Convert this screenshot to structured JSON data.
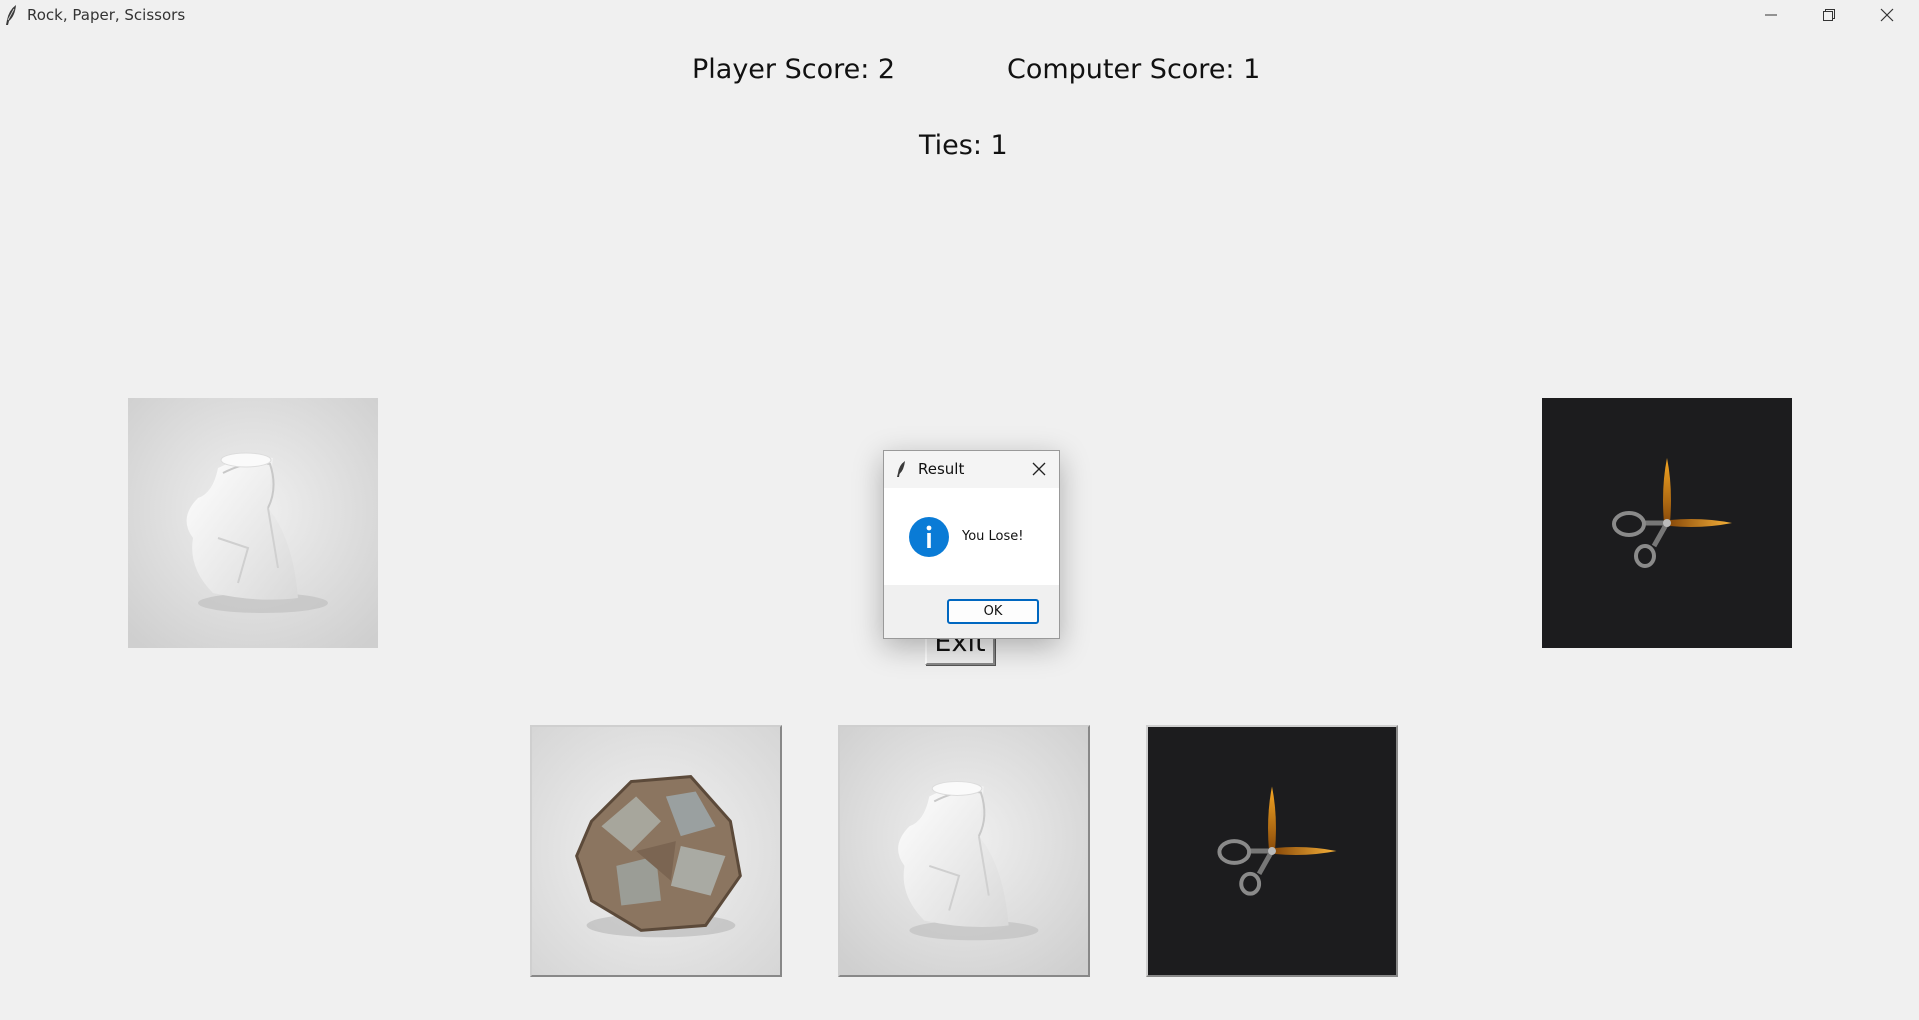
{
  "window": {
    "title": "Rock, Paper, Scissors",
    "icon": "feather-icon",
    "controls": [
      "minimize-icon",
      "restore-icon",
      "close-icon"
    ]
  },
  "scores": {
    "player": "Player Score: 2",
    "computer": "Computer Score: 1",
    "ties": "Ties: 1"
  },
  "round": {
    "player_choice": "paper",
    "computer_choice": "scissors"
  },
  "exit_button": {
    "label": "Exit"
  },
  "choices": [
    "rock",
    "paper",
    "scissors"
  ],
  "dialog": {
    "title": "Result",
    "icon": "info-icon",
    "message": "You Lose!",
    "ok_label": "OK"
  },
  "colors": {
    "background": "#f0f0f0",
    "dark_tile": "#1c1c1e",
    "info_blue": "#0a7bd6",
    "ok_border": "#0067c0"
  }
}
